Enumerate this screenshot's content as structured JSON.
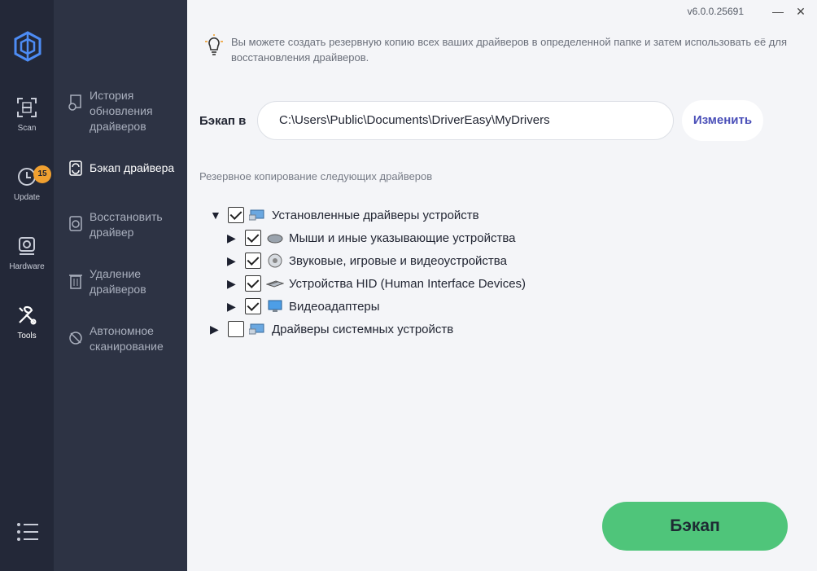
{
  "window": {
    "version": "v6.0.0.25691",
    "minimize": "—",
    "close": "✕"
  },
  "left_nav": [
    {
      "label": "Scan",
      "icon": "scan-icon"
    },
    {
      "label": "Update",
      "icon": "update-icon",
      "badge": "15"
    },
    {
      "label": "Hardware",
      "icon": "hardware-icon"
    },
    {
      "label": "Tools",
      "icon": "tools-icon",
      "active": true
    }
  ],
  "sub_nav": [
    {
      "label": "История обновления драйверов",
      "icon": "history-icon"
    },
    {
      "label": "Бэкап драйвера",
      "icon": "backup-icon",
      "active": true
    },
    {
      "label": "Восстановить драйвер",
      "icon": "restore-icon"
    },
    {
      "label": "Удаление драйверов",
      "icon": "uninstall-icon"
    },
    {
      "label": "Автономное сканирование",
      "icon": "offline-scan-icon"
    }
  ],
  "info_text": "Вы можете создать резервную копию всех ваших драйверов в определенной папке и затем использовать её для восстановления драйверов.",
  "backup": {
    "label": "Бэкап в",
    "path": "C:\\Users\\Public\\Documents\\DriverEasy\\MyDrivers",
    "change_button": "Изменить"
  },
  "section_title": "Резервное копирование следующих драйверов",
  "tree": [
    {
      "label": "Установленные драйверы устройств",
      "expanded": true,
      "checked": true,
      "level": 0,
      "icon": "devices-icon"
    },
    {
      "label": "Мыши и иные указывающие устройства",
      "expanded": false,
      "checked": true,
      "level": 1,
      "icon": "mouse-icon"
    },
    {
      "label": "Звуковые, игровые и видеоустройства",
      "expanded": false,
      "checked": true,
      "level": 1,
      "icon": "speaker-icon"
    },
    {
      "label": "Устройства HID (Human Interface Devices)",
      "expanded": false,
      "checked": true,
      "level": 1,
      "icon": "hid-icon"
    },
    {
      "label": "Видеоадаптеры",
      "expanded": false,
      "checked": true,
      "level": 1,
      "icon": "display-adapter-icon"
    },
    {
      "label": "Драйверы системных устройств",
      "expanded": false,
      "checked": false,
      "level": 0,
      "icon": "system-devices-icon"
    }
  ],
  "backup_button": "Бэкап",
  "colors": {
    "accent_green": "#4fc57a",
    "link_blue": "#4a4fb8",
    "sidebar_dark": "#232838",
    "subbar": "#2d3344",
    "badge": "#f0a030"
  }
}
